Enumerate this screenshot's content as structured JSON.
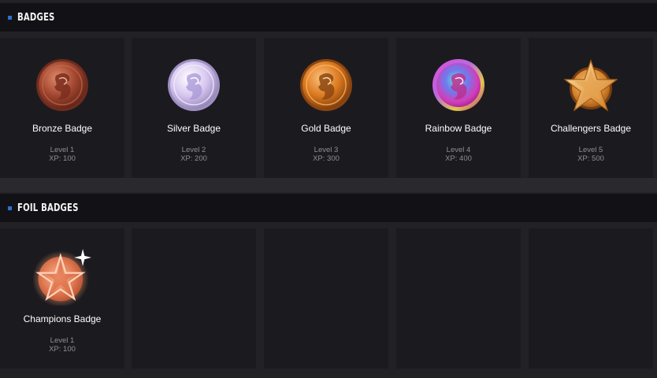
{
  "sections": [
    {
      "title": "BADGES",
      "badges": [
        {
          "name": "Bronze Badge",
          "level": "Level 1",
          "xp": "XP: 100",
          "icon": "bronze-coin-icon",
          "color": "#a0452f"
        },
        {
          "name": "Silver Badge",
          "level": "Level 2",
          "xp": "XP: 200",
          "icon": "silver-coin-icon",
          "color": "#c9b5e8"
        },
        {
          "name": "Gold Badge",
          "level": "Level 3",
          "xp": "XP: 300",
          "icon": "gold-coin-icon",
          "color": "#d9781f"
        },
        {
          "name": "Rainbow Badge",
          "level": "Level 4",
          "xp": "XP: 400",
          "icon": "rainbow-coin-icon",
          "color": "#d03cc8"
        },
        {
          "name": "Challengers Badge",
          "level": "Level 5",
          "xp": "XP: 500",
          "icon": "star-medal-icon",
          "color": "#e2952c"
        }
      ]
    },
    {
      "title": "FOIL BADGES",
      "badges": [
        {
          "name": "Champions Badge",
          "level": "Level 1",
          "xp": "XP: 100",
          "icon": "foil-star-medal-icon",
          "color": "#e8885f"
        }
      ]
    }
  ],
  "colors": {
    "accent": "#2f6fd0",
    "header_bg": "#121216",
    "card_bg": "#1b1b1f",
    "page_bg": "#222226"
  }
}
